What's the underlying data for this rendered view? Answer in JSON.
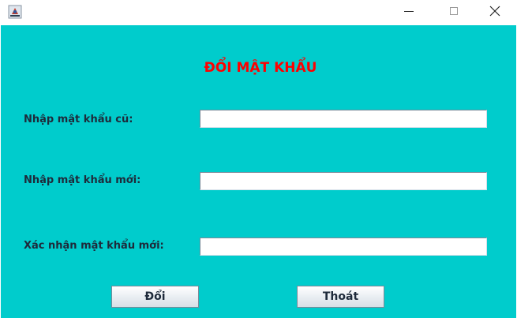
{
  "titlebar": {
    "icon": "java-cup-icon",
    "controls": {
      "minimize": "minimize-icon",
      "maximize": "maximize-icon",
      "close": "close-icon"
    }
  },
  "form": {
    "title": "ĐỔI MẬT KHẨU",
    "old_password_label": "Nhập mật khẩu cũ:",
    "old_password_value": "",
    "new_password_label": "Nhập mật khẩu mới:",
    "new_password_value": "",
    "confirm_password_label": "Xác nhận mật khẩu mới:",
    "confirm_password_value": ""
  },
  "buttons": {
    "change_label": "Đổi",
    "exit_label": "Thoát"
  },
  "colors": {
    "background": "#00cccc",
    "title": "#ff0000"
  }
}
